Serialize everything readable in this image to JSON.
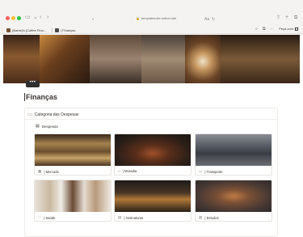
{
  "browser": {
    "url": "templatesuite.notion.site",
    "tabs": [
      {
        "label": "[Name]'s {Coffee Fina..."
      },
      {
        "label": "| Finanças"
      }
    ],
    "share_label": "Peça com"
  },
  "page": {
    "cover_button_label": "•••",
    "title": "Finanças"
  },
  "database": {
    "title": "Categoria das Despesas",
    "view_label": "Despesas",
    "cards": [
      {
        "label": "| Mercado",
        "icon": "cart-icon",
        "color": "#5a4630"
      },
      {
        "label": "| Moradia",
        "icon": "house-icon",
        "color": "#2e2622"
      },
      {
        "label": "| Transporte",
        "icon": "car-icon",
        "color": "#3c4046"
      },
      {
        "label": "| Saúde",
        "icon": "heart-icon",
        "color": "#d7cfc4"
      },
      {
        "label": "| Assinaturas",
        "icon": "receipt-icon",
        "color": "#2a2520"
      },
      {
        "label": "| Estudos",
        "icon": "book-icon",
        "color": "#5f5048"
      }
    ]
  },
  "colors": {
    "accent_red": "#ff5f57",
    "accent_yellow": "#febc2e",
    "accent_green": "#28c840",
    "text": "#37352f"
  }
}
